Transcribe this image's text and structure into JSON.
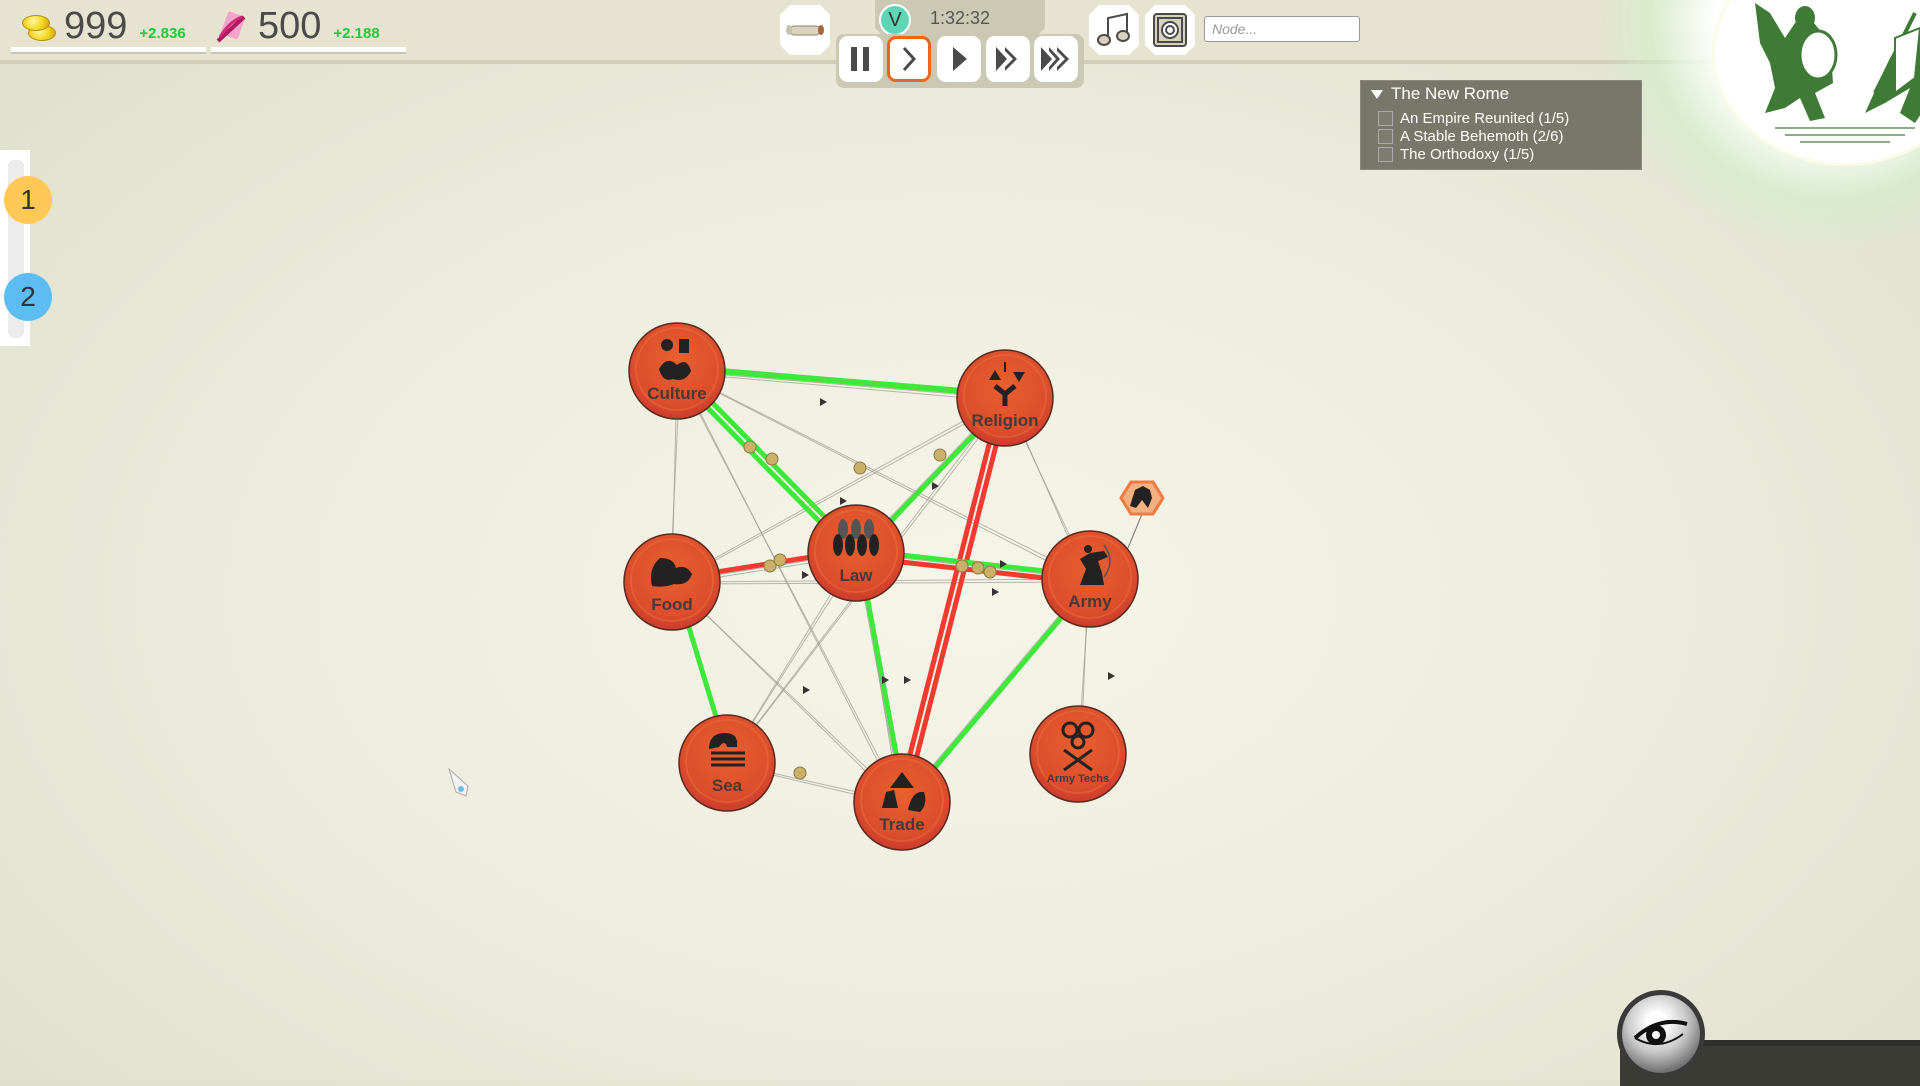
{
  "resources": {
    "gold": {
      "icon": "gold-coins-icon",
      "value": "999",
      "delta": "+2.836"
    },
    "parchment": {
      "icon": "quill-scroll-icon",
      "value": "500",
      "delta": "+2.188"
    }
  },
  "toolbar": {
    "scroll_button": "scroll-icon",
    "victory_badge": "V",
    "timer": "1:32:32",
    "speed_buttons": [
      {
        "name": "pause",
        "glyph": "pause",
        "active": false
      },
      {
        "name": "slow",
        "glyph": "chevron",
        "active": true
      },
      {
        "name": "normal",
        "glyph": "play",
        "active": false
      },
      {
        "name": "fast",
        "glyph": "double",
        "active": false
      },
      {
        "name": "fastest",
        "glyph": "triple",
        "active": false
      }
    ],
    "music_button": "music-note-icon",
    "sound_button": "speaker-icon",
    "node_search_placeholder": "Node..."
  },
  "objectives": {
    "title": "The New Rome",
    "items": [
      {
        "label": "An Empire Reunited (1/5)",
        "checked": false
      },
      {
        "label": "A Stable Behemoth (2/6)",
        "checked": false
      },
      {
        "label": "The Orthodoxy (1/5)",
        "checked": false
      }
    ]
  },
  "player_slots": [
    {
      "label": "1",
      "color": "#ffc857"
    },
    {
      "label": "2",
      "color": "#5ebcf5"
    }
  ],
  "graph": {
    "node_color": "#e04a2c",
    "positive_link_color": "#3ee83a",
    "negative_link_color": "#f23a30",
    "nodes": [
      {
        "id": "culture",
        "label": "Culture",
        "icon": "culture-masks-icon"
      },
      {
        "id": "religion",
        "label": "Religion",
        "icon": "religion-figure-icon"
      },
      {
        "id": "food",
        "label": "Food",
        "icon": "food-meat-icon"
      },
      {
        "id": "law",
        "label": "Law",
        "icon": "law-people-icon"
      },
      {
        "id": "army",
        "label": "Army",
        "icon": "army-archer-icon"
      },
      {
        "id": "sea",
        "label": "Sea",
        "icon": "sea-waves-icon"
      },
      {
        "id": "trade",
        "label": "Trade",
        "icon": "trade-merchants-icon"
      },
      {
        "id": "armytechs",
        "label": "Army Techs",
        "icon": "army-techs-gears-swords-icon"
      }
    ],
    "links": [
      {
        "from": "culture",
        "to": "religion",
        "type": "positive"
      },
      {
        "from": "religion",
        "to": "culture",
        "type": "positive"
      },
      {
        "from": "culture",
        "to": "law",
        "type": "positive"
      },
      {
        "from": "culture",
        "to": "law",
        "type": "positive"
      },
      {
        "from": "religion",
        "to": "law",
        "type": "positive"
      },
      {
        "from": "religion",
        "to": "trade",
        "type": "negative"
      },
      {
        "from": "religion",
        "to": "trade",
        "type": "negative"
      },
      {
        "from": "food",
        "to": "law",
        "type": "negative"
      },
      {
        "from": "law",
        "to": "army",
        "type": "positive"
      },
      {
        "from": "law",
        "to": "army",
        "type": "negative"
      },
      {
        "from": "food",
        "to": "sea",
        "type": "positive"
      },
      {
        "from": "law",
        "to": "trade",
        "type": "positive"
      },
      {
        "from": "army",
        "to": "trade",
        "type": "positive"
      }
    ],
    "unit_marker": "cavalry-hex-icon"
  },
  "bottom": {
    "eye_button": "eye-icon"
  }
}
